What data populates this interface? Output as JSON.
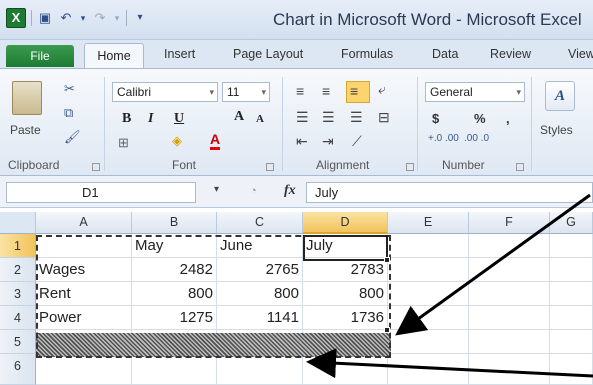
{
  "window": {
    "title": "Chart in Microsoft Word - Microsoft Excel",
    "app_logo": "X"
  },
  "quick_access": {
    "icons": [
      "save-icon",
      "undo-icon",
      "redo-icon",
      "customize-icon"
    ]
  },
  "tabs": {
    "file": "File",
    "home": "Home",
    "insert": "Insert",
    "page_layout": "Page Layout",
    "formulas": "Formulas",
    "data": "Data",
    "review": "Review",
    "view": "View"
  },
  "ribbon": {
    "clipboard": {
      "label": "Clipboard",
      "paste": "Paste"
    },
    "font": {
      "label": "Font",
      "name": "Calibri",
      "size": "11",
      "bold": "B",
      "italic": "I",
      "underline": "U",
      "grow": "A",
      "shrink": "A",
      "font_color": "A"
    },
    "alignment": {
      "label": "Alignment"
    },
    "number": {
      "label": "Number",
      "format": "General",
      "currency": "$",
      "percent": "%",
      "comma": ",",
      "inc_decimal": "+.0 .00",
      "dec_decimal": ".00 →.0"
    },
    "styles": {
      "label": "Styles"
    }
  },
  "formula_bar": {
    "name_box": "D1",
    "fx": "fx",
    "content": "July"
  },
  "sheet": {
    "columns": [
      "A",
      "B",
      "C",
      "D",
      "E",
      "F",
      "G"
    ],
    "rows": [
      "1",
      "2",
      "3",
      "4",
      "5",
      "6"
    ],
    "cells": {
      "B1": "May",
      "C1": "June",
      "D1": "July",
      "A2": "Wages",
      "B2": "2482",
      "C2": "2765",
      "D2": "2783",
      "A3": "Rent",
      "B3": "800",
      "C3": "800",
      "D3": "800",
      "A4": "Power",
      "B4": "1275",
      "C4": "1141",
      "D4": "1736"
    },
    "active_cell": "D1"
  },
  "colors": {
    "excel_green": "#1e7b34",
    "selection_highlight": "#f2c35b",
    "ribbon_bg": "#dfe8f3"
  }
}
